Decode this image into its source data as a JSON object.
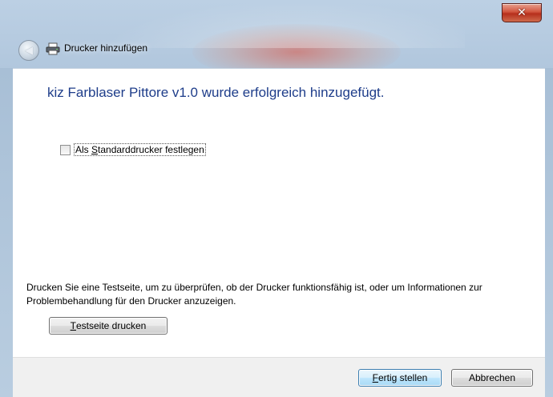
{
  "window": {
    "title": "Drucker hinzufügen",
    "close_symbol": "✕"
  },
  "icons": {
    "back": "back-arrow-icon",
    "printer": "printer-icon",
    "close": "close-icon"
  },
  "main": {
    "heading": "kiz Farblaser Pittore v1.0 wurde erfolgreich hinzugefügt.",
    "default_checkbox": {
      "label_prefix": "Als ",
      "label_accel": "S",
      "label_suffix": "tandarddrucker festlegen",
      "checked": false
    },
    "info_text": "Drucken Sie eine Testseite, um zu überprüfen, ob der Drucker funktionsfähig ist, oder um Informationen zur Problembehandlung für den Drucker anzuzeigen.",
    "test_button": {
      "accel": "T",
      "rest": "estseite drucken"
    }
  },
  "footer": {
    "finish_button": {
      "accel": "F",
      "rest": "ertig stellen"
    },
    "cancel_label": "Abbrechen"
  },
  "colors": {
    "heading": "#1e3d8a",
    "close_button": "#c9462e"
  }
}
